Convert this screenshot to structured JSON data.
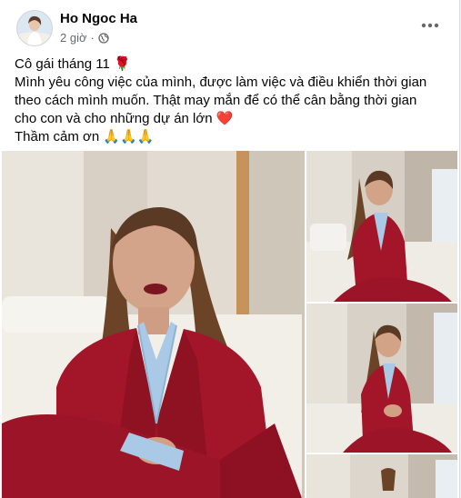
{
  "post": {
    "author": "Ho Ngoc Ha",
    "time": "2 giờ",
    "separator": "·",
    "privacy_icon": "globe-icon",
    "more_icon": "more-horizontal-icon",
    "lines": [
      "Cô gái tháng 11 🌹",
      "Mình yêu công việc của mình, được làm việc và điều khiển thời gian theo cách mình muốn. Thật may mắn để có thể cân bằng thời gian cho con và cho những dự án lớn ❤️",
      "Thầm cảm ơn 🙏🙏🙏"
    ]
  },
  "colors": {
    "text": "#050505",
    "secondary": "#65676b",
    "suit": "#a3162a",
    "shirt": "#a9c9e6"
  }
}
